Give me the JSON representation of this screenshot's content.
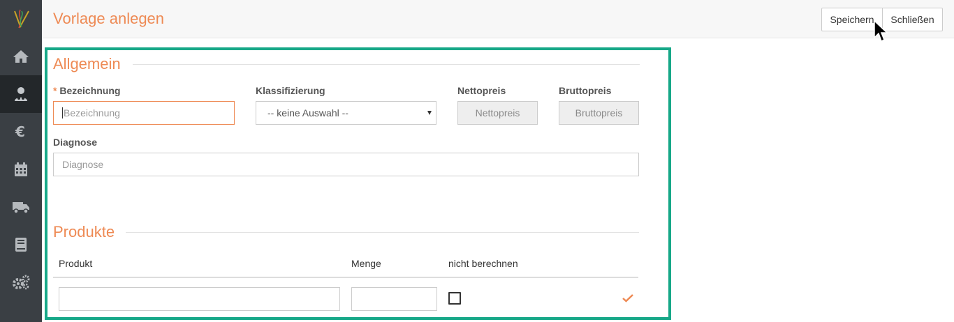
{
  "header": {
    "title": "Vorlage anlegen",
    "save_label": "Speichern",
    "close_label": "Schließen"
  },
  "sidebar": {
    "items": [
      {
        "icon": "home-icon"
      },
      {
        "icon": "patient-icon",
        "active": true
      },
      {
        "icon": "euro-icon"
      },
      {
        "icon": "calendar-icon"
      },
      {
        "icon": "truck-icon"
      },
      {
        "icon": "book-icon"
      },
      {
        "icon": "gears-icon"
      }
    ]
  },
  "general": {
    "section_title": "Allgemein",
    "required_marker": "*",
    "bezeichnung_label": "Bezeichnung",
    "bezeichnung_placeholder": "Bezeichnung",
    "klassifizierung_label": "Klassifizierung",
    "klassifizierung_value": "-- keine Auswahl --",
    "nettopreis_label": "Nettopreis",
    "nettopreis_placeholder": "Nettopreis",
    "bruttopreis_label": "Bruttopreis",
    "bruttopreis_placeholder": "Bruttopreis",
    "diagnose_label": "Diagnose",
    "diagnose_placeholder": "Diagnose"
  },
  "products": {
    "section_title": "Produkte",
    "columns": [
      "Produkt",
      "Menge",
      "nicht berechnen"
    ],
    "rows": [
      {
        "produkt": "",
        "menge": "",
        "nicht_berechnen": false
      }
    ]
  },
  "colors": {
    "accent": "#ee8a54",
    "highlight_frame": "#17a888",
    "sidebar_bg": "#3a3f44"
  }
}
